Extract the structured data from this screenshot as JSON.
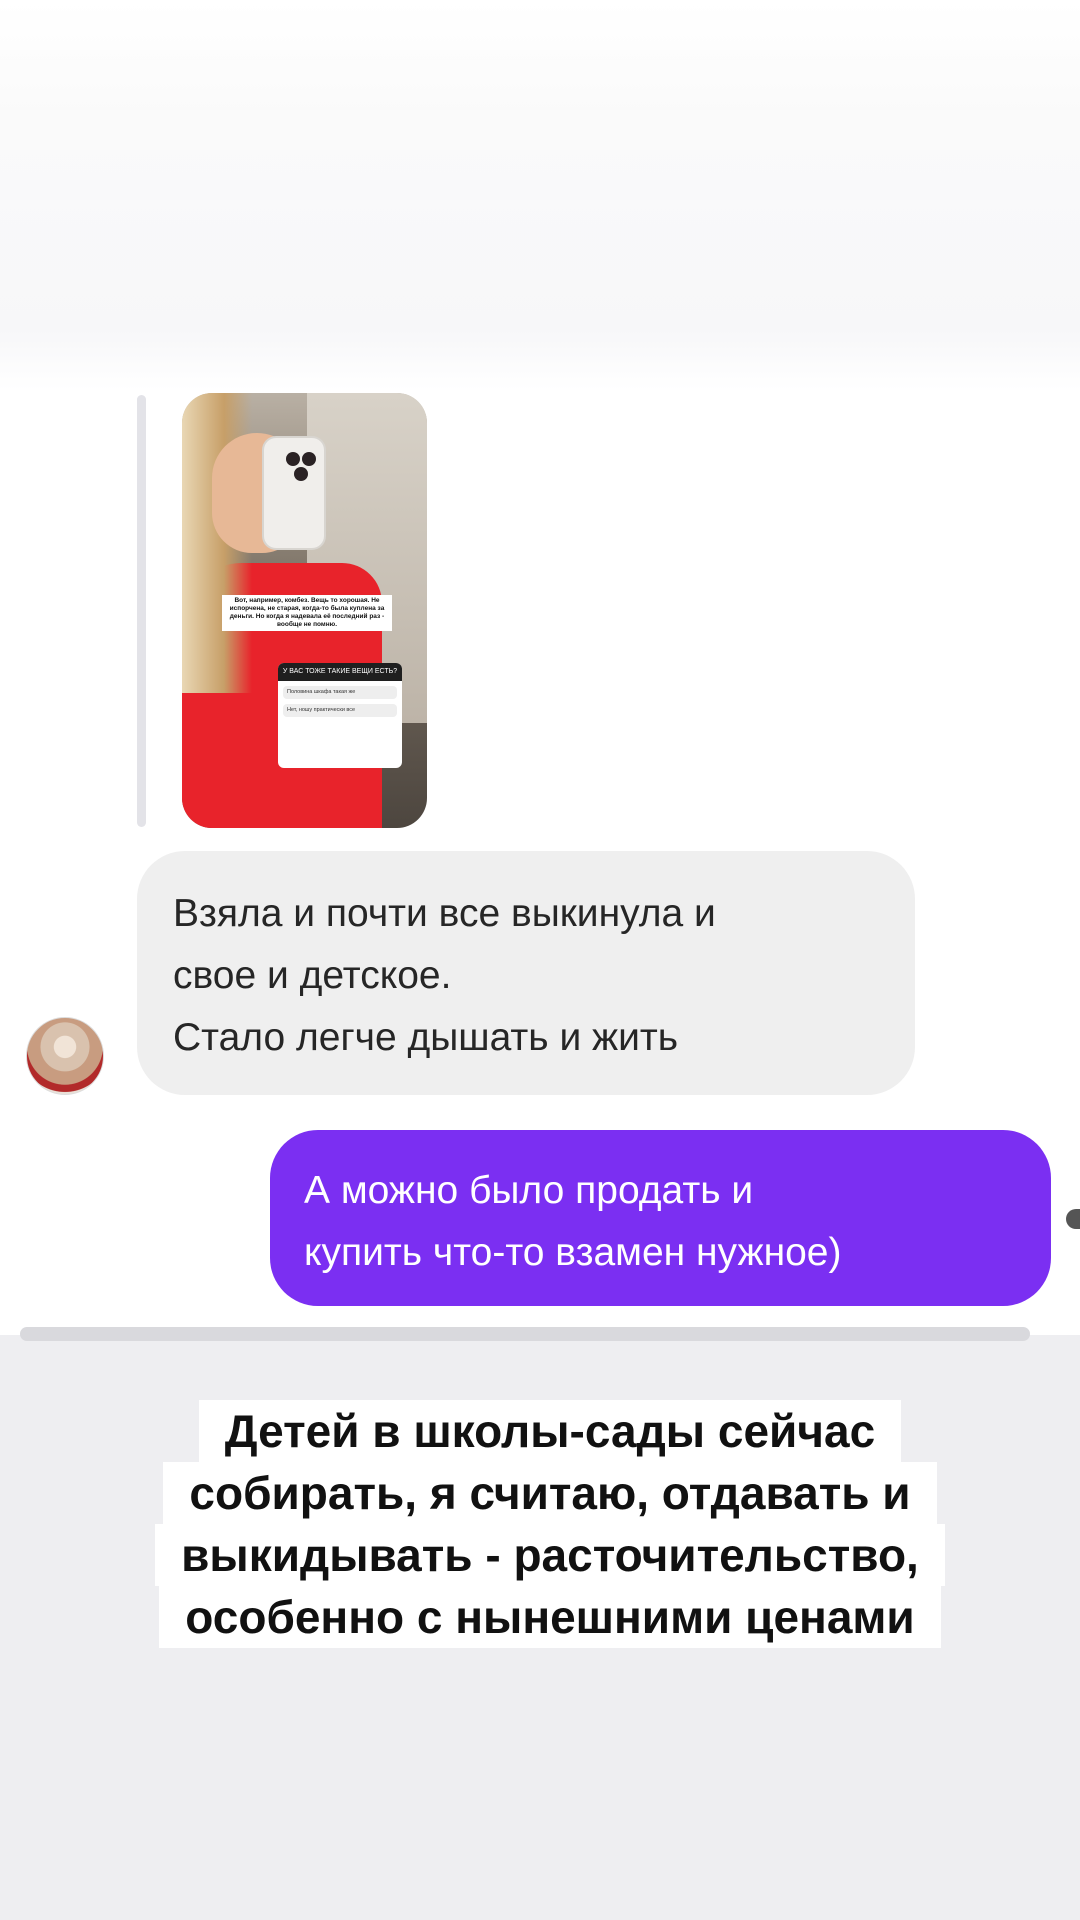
{
  "story_preview": {
    "caption": "Вот, например, комбез. Вещь то хорошая. Не испорчена, не старая, когда-то была куплена за деньги. Но когда я надевала её последний раз - вообще не помню.",
    "quiz_question": "У ВАС ТОЖЕ ТАКИЕ ВЕЩИ ЕСТЬ?",
    "quiz_options": [
      "Половина шкафа такая же",
      "Нет, ношу практически все"
    ]
  },
  "messages": {
    "incoming": {
      "lines": [
        "Взяла и почти все выкинула и",
        "свое и детское.",
        "Стало легче дышать и жить"
      ]
    },
    "outgoing": {
      "lines": [
        "А можно было продать и",
        "купить что-то взамен нужное)"
      ]
    }
  },
  "caption": {
    "lines": [
      "Детей в школы-сады сейчас",
      "собирать, я считаю, отдавать и",
      "выкидывать - расточительство,",
      "особенно с нынешними ценами"
    ]
  },
  "colors": {
    "outgoing_bubble": "#7b2ff2",
    "incoming_bubble": "#efefef",
    "background_lower": "#eeeef1"
  },
  "icons": {
    "avatar": "user-avatar"
  }
}
